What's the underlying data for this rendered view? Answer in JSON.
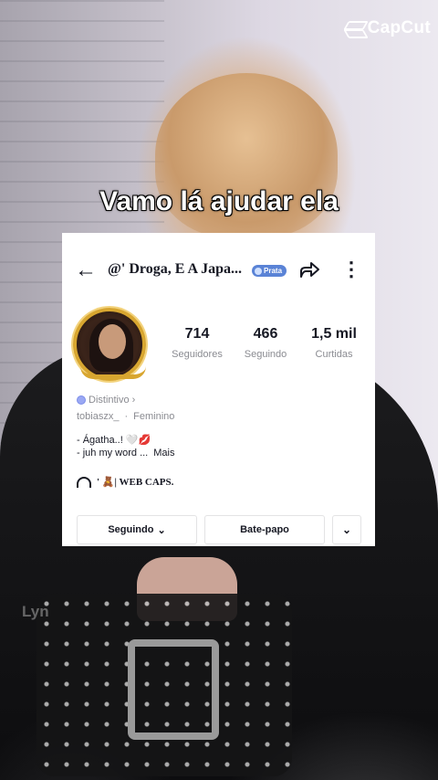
{
  "watermark_brand": "CapCut",
  "caption": "Vamo lá ajudar ela",
  "profile": {
    "title": "@' Droga, E A Japa...",
    "badge": "Prata",
    "stats": [
      {
        "value": "714",
        "label": "Seguidores"
      },
      {
        "value": "466",
        "label": "Seguindo"
      },
      {
        "value": "1,5 mil",
        "label": "Curtidas"
      }
    ],
    "distintivo": "Distintivo ›",
    "username": "tobiaszx_",
    "gender": "Feminino",
    "bio_line1": "- Ágatha..! 🤍💋",
    "bio_line2": "- juh my word ...",
    "bio_more": "Mais",
    "link_text": "' 🧸| WEB CAPS.",
    "buttons": {
      "following": "Seguindo",
      "chat": "Bate-papo"
    }
  },
  "corner_text": "Lyn",
  "icons": {
    "back": "arrow-left-icon",
    "share": "share-icon",
    "more": "more-vertical-icon",
    "dropdown": "chevron-down-icon"
  }
}
